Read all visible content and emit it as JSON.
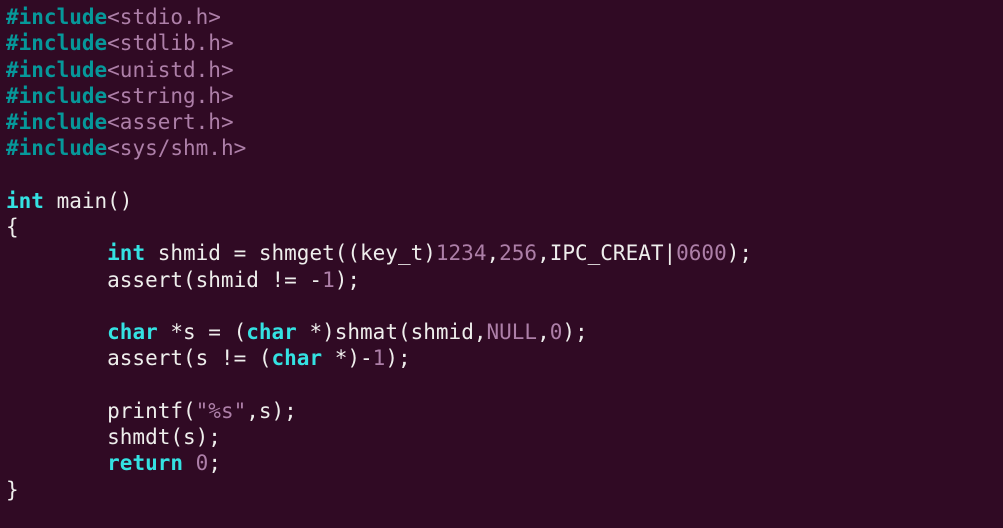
{
  "code": {
    "lines": [
      [
        {
          "t": "#include",
          "c": "kw-pre"
        },
        {
          "t": "<stdio.h>",
          "c": "hdr"
        }
      ],
      [
        {
          "t": "#include",
          "c": "kw-pre"
        },
        {
          "t": "<stdlib.h>",
          "c": "hdr"
        }
      ],
      [
        {
          "t": "#include",
          "c": "kw-pre"
        },
        {
          "t": "<unistd.h>",
          "c": "hdr"
        }
      ],
      [
        {
          "t": "#include",
          "c": "kw-pre"
        },
        {
          "t": "<string.h>",
          "c": "hdr"
        }
      ],
      [
        {
          "t": "#include",
          "c": "kw-pre"
        },
        {
          "t": "<assert.h>",
          "c": "hdr"
        }
      ],
      [
        {
          "t": "#include",
          "c": "kw-pre"
        },
        {
          "t": "<sys/shm.h>",
          "c": "hdr"
        }
      ],
      [],
      [
        {
          "t": "int",
          "c": "kw-type"
        },
        {
          "t": " main()",
          "c": "func"
        }
      ],
      [
        {
          "t": "{",
          "c": "op"
        }
      ],
      [
        {
          "t": "        ",
          "c": "op"
        },
        {
          "t": "int",
          "c": "kw-type"
        },
        {
          "t": " shmid = shmget((key_t)",
          "c": "ident"
        },
        {
          "t": "1234",
          "c": "num"
        },
        {
          "t": ",",
          "c": "op"
        },
        {
          "t": "256",
          "c": "num"
        },
        {
          "t": ",IPC_CREAT|",
          "c": "ident"
        },
        {
          "t": "0600",
          "c": "num"
        },
        {
          "t": ");",
          "c": "op"
        }
      ],
      [
        {
          "t": "        assert(shmid != -",
          "c": "ident"
        },
        {
          "t": "1",
          "c": "num"
        },
        {
          "t": ");",
          "c": "op"
        }
      ],
      [],
      [
        {
          "t": "        ",
          "c": "op"
        },
        {
          "t": "char",
          "c": "kw-type"
        },
        {
          "t": " *s = (",
          "c": "ident"
        },
        {
          "t": "char",
          "c": "kw-type"
        },
        {
          "t": " *)shmat(shmid,",
          "c": "ident"
        },
        {
          "t": "NULL",
          "c": "kw-const"
        },
        {
          "t": ",",
          "c": "op"
        },
        {
          "t": "0",
          "c": "num"
        },
        {
          "t": ");",
          "c": "op"
        }
      ],
      [
        {
          "t": "        assert(s != (",
          "c": "ident"
        },
        {
          "t": "char",
          "c": "kw-type"
        },
        {
          "t": " *)-",
          "c": "ident"
        },
        {
          "t": "1",
          "c": "num"
        },
        {
          "t": ");",
          "c": "op"
        }
      ],
      [],
      [
        {
          "t": "        printf(",
          "c": "ident"
        },
        {
          "t": "\"%s\"",
          "c": "str"
        },
        {
          "t": ",s);",
          "c": "ident"
        }
      ],
      [
        {
          "t": "        shmdt(s);",
          "c": "ident"
        }
      ],
      [
        {
          "t": "        ",
          "c": "op"
        },
        {
          "t": "return",
          "c": "kw-type"
        },
        {
          "t": " ",
          "c": "op"
        },
        {
          "t": "0",
          "c": "num"
        },
        {
          "t": ";",
          "c": "op"
        }
      ],
      [
        {
          "t": "}",
          "c": "op"
        }
      ]
    ]
  }
}
